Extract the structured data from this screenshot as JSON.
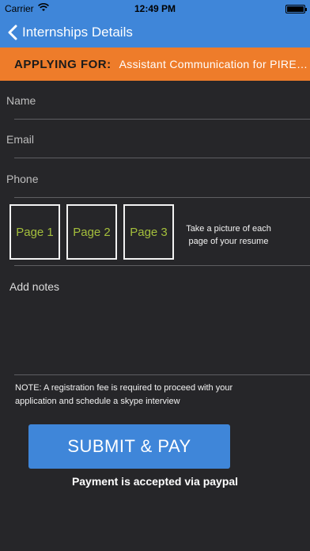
{
  "status_bar": {
    "carrier": "Carrier",
    "time": "12:49 PM"
  },
  "nav": {
    "back_label": "Internships Details"
  },
  "applying": {
    "label": "APPLYING FOR:",
    "title": "Assistant Communication for PIRE…"
  },
  "form": {
    "name_placeholder": "Name",
    "email_placeholder": "Email",
    "phone_placeholder": "Phone",
    "pages": [
      "Page 1",
      "Page 2",
      "Page 3"
    ],
    "pages_hint": "Take a picture of each page of your resume",
    "notes_placeholder": "Add notes"
  },
  "note_text": "NOTE: A registration fee is required to proceed with your application and schedule a skype interview",
  "submit_label": "SUBMIT & PAY",
  "payment_note": "Payment is accepted via paypal",
  "colors": {
    "nav_blue": "#3f86d9",
    "apply_orange": "#ee7c2a",
    "background": "#262629",
    "page_text": "#a4bf3c"
  }
}
